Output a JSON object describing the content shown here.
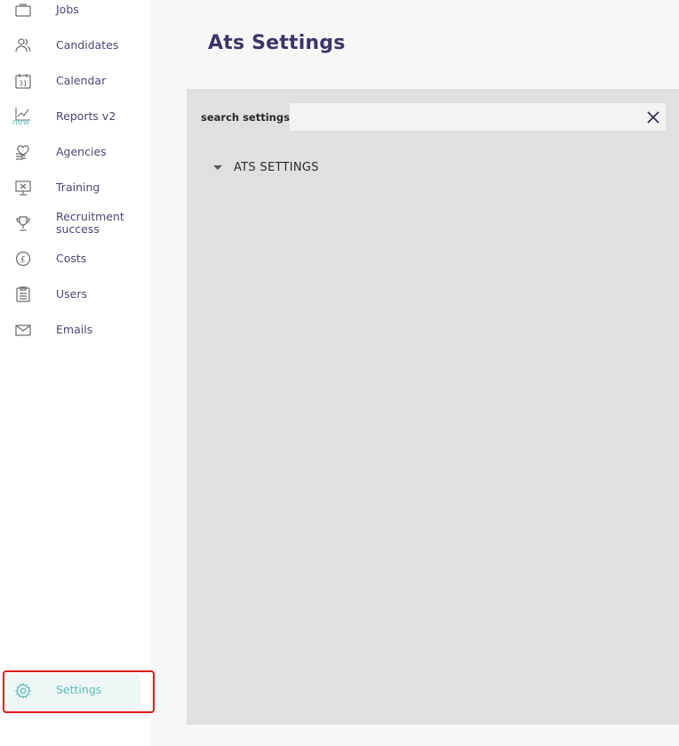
{
  "sidebar": {
    "items": [
      {
        "label": "Jobs",
        "icon": "briefcase-icon"
      },
      {
        "label": "Candidates",
        "icon": "users-icon"
      },
      {
        "label": "Calendar",
        "icon": "calendar-icon",
        "icon_text": "31"
      },
      {
        "label": "Reports v2",
        "icon": "chart-icon",
        "badge": "new"
      },
      {
        "label": "Agencies",
        "icon": "handshake-icon"
      },
      {
        "label": "Training",
        "icon": "presentation-icon"
      },
      {
        "label": "Recruitment success",
        "icon": "trophy-icon"
      },
      {
        "label": "Costs",
        "icon": "pound-coin-icon",
        "icon_text": "£"
      },
      {
        "label": "Users",
        "icon": "clipboard-icon"
      },
      {
        "label": "Emails",
        "icon": "envelope-icon"
      }
    ],
    "settings": {
      "label": "Settings",
      "icon": "gear-icon"
    }
  },
  "main": {
    "title": "Ats Settings",
    "search": {
      "label": "search settings",
      "value": "",
      "placeholder": ""
    },
    "tree": [
      {
        "label": "ATS SETTINGS",
        "expanded": false
      }
    ]
  },
  "colors": {
    "accent": "#5cbcb8",
    "text": "#3f3a6b",
    "highlight": "#e01b1b",
    "panel": "#e0e0e0"
  }
}
